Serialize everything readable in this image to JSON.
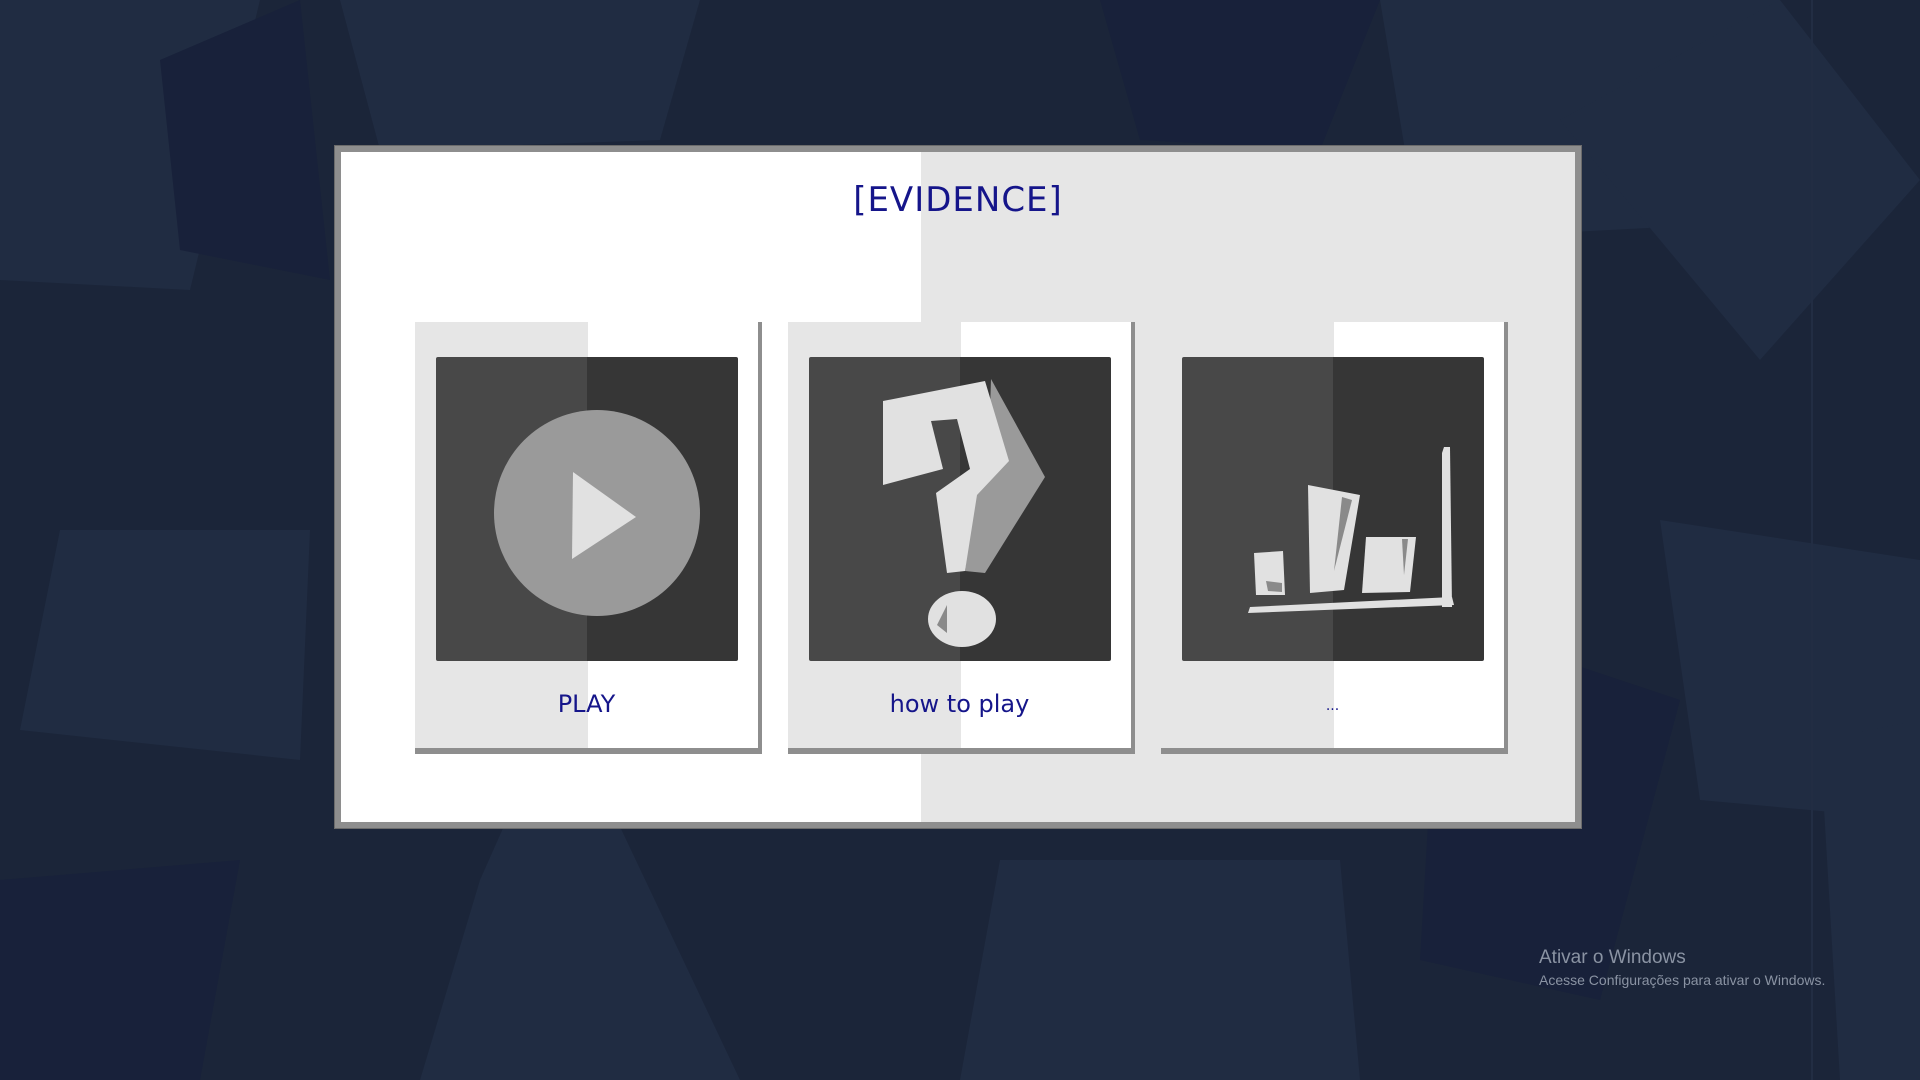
{
  "title": "[EVIDENCE]",
  "menu": {
    "play_label": "PLAY",
    "how_to_play_label": "how to play",
    "third_label": "..."
  },
  "icons": {
    "play": "play-circle-icon",
    "how_to_play": "question-mark-icon",
    "third": "bar-chart-icon"
  },
  "windows_watermark": {
    "line1": "Ativar o Windows",
    "line2": "Acesse Configurações para ativar o Windows."
  },
  "colors": {
    "background": "#1b2539",
    "title_text": "#15158a",
    "panel_border": "#8e8e8e",
    "thumb_dark": "#363636",
    "thumb_mid": "#484848"
  }
}
